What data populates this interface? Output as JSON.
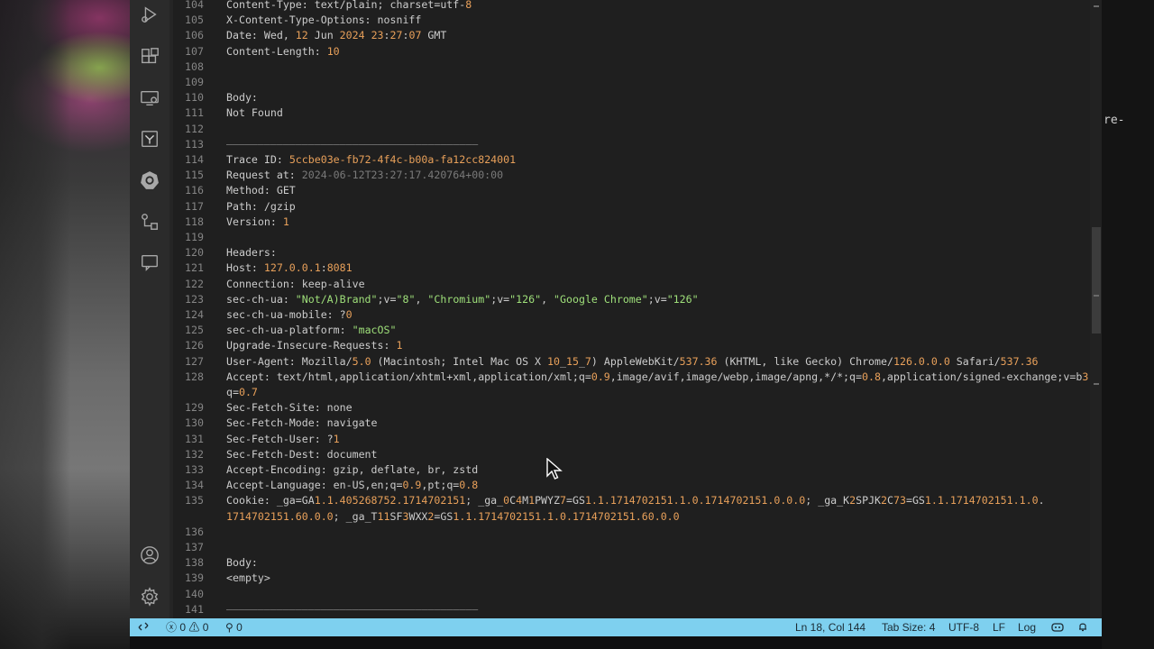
{
  "desktop": {
    "right_fragment": "re-"
  },
  "activity_bar": {
    "icons": [
      "run-debug-icon",
      "extensions-icon",
      "remote-explorer-icon",
      "http-client-icon",
      "kubernetes-icon",
      "source-control-graph-icon",
      "comments-icon",
      "accounts-icon",
      "settings-gear-icon"
    ]
  },
  "editor": {
    "lines": [
      {
        "no": "104",
        "text": "Content-Type: text/plain; charset=utf-8"
      },
      {
        "no": "105",
        "text": "X-Content-Type-Options: nosniff"
      },
      {
        "no": "106",
        "text": "Date: Wed, 12 Jun 2024 23:27:07 GMT"
      },
      {
        "no": "107",
        "text": "Content-Length: 10"
      },
      {
        "no": "108",
        "text": ""
      },
      {
        "no": "109",
        "text": ""
      },
      {
        "no": "110",
        "text": "Body:"
      },
      {
        "no": "111",
        "text": "Not Found"
      },
      {
        "no": "112",
        "text": ""
      },
      {
        "no": "113",
        "text": "————————————————————————————————————————"
      },
      {
        "no": "114",
        "text": "Trace ID: 5ccbe03e-fb72-4f4c-b00a-fa12cc824001"
      },
      {
        "no": "115",
        "text": "Request at: 2024-06-12T23:27:17.420764+00:00"
      },
      {
        "no": "116",
        "text": "Method: GET"
      },
      {
        "no": "117",
        "text": "Path: /gzip"
      },
      {
        "no": "118",
        "text": "Version: 1"
      },
      {
        "no": "119",
        "text": ""
      },
      {
        "no": "120",
        "text": "Headers:"
      },
      {
        "no": "121",
        "text": "Host: 127.0.0.1:8081"
      },
      {
        "no": "122",
        "text": "Connection: keep-alive"
      },
      {
        "no": "123",
        "text": "sec-ch-ua: \"Not/A)Brand\";v=\"8\", \"Chromium\";v=\"126\", \"Google Chrome\";v=\"126\""
      },
      {
        "no": "124",
        "text": "sec-ch-ua-mobile: ?0"
      },
      {
        "no": "125",
        "text": "sec-ch-ua-platform: \"macOS\""
      },
      {
        "no": "126",
        "text": "Upgrade-Insecure-Requests: 1"
      },
      {
        "no": "127",
        "text": "User-Agent: Mozilla/5.0 (Macintosh; Intel Mac OS X 10_15_7) AppleWebKit/537.36 (KHTML, like Gecko) Chrome/126.0.0.0 Safari/537.36"
      },
      {
        "no": "128",
        "text": "Accept: text/html,application/xhtml+xml,application/xml;q=0.9,image/avif,image/webp,image/apng,*/*;q=0.8,application/signed-exchange;v=b3;"
      },
      {
        "no": "",
        "text": "q=0.7"
      },
      {
        "no": "129",
        "text": "Sec-Fetch-Site: none"
      },
      {
        "no": "130",
        "text": "Sec-Fetch-Mode: navigate"
      },
      {
        "no": "131",
        "text": "Sec-Fetch-User: ?1"
      },
      {
        "no": "132",
        "text": "Sec-Fetch-Dest: document"
      },
      {
        "no": "133",
        "text": "Accept-Encoding: gzip, deflate, br, zstd"
      },
      {
        "no": "134",
        "text": "Accept-Language: en-US,en;q=0.9,pt;q=0.8"
      },
      {
        "no": "135",
        "text": "Cookie: _ga=GA1.1.405268752.1714702151; _ga_0C4M1PWYZ7=GS1.1.1714702151.1.0.1714702151.0.0.0; _ga_K2SPJK2C73=GS1.1.1714702151.1.0."
      },
      {
        "no": "",
        "text": "1714702151.60.0.0; _ga_T11SF3WXX2=GS1.1.1714702151.1.0.1714702151.60.0.0"
      },
      {
        "no": "136",
        "text": ""
      },
      {
        "no": "137",
        "text": ""
      },
      {
        "no": "138",
        "text": "Body:"
      },
      {
        "no": "139",
        "text": "<empty>"
      },
      {
        "no": "140",
        "text": ""
      },
      {
        "no": "141",
        "text": "————————————————————————————————————————"
      }
    ]
  },
  "status_bar": {
    "remote_icon": "remote-icon",
    "errors": "0",
    "warnings": "0",
    "ports": "0",
    "position": "Ln 18, Col 144",
    "tab_size": "Tab Size: 4",
    "encoding": "UTF-8",
    "eol": "LF",
    "language": "Log"
  },
  "colors": {
    "status_bar_bg": "#7ed0ef",
    "number_highlight": "#e8a05a",
    "string_highlight": "#9fe07a",
    "editor_bg": "#1f1f1f"
  }
}
